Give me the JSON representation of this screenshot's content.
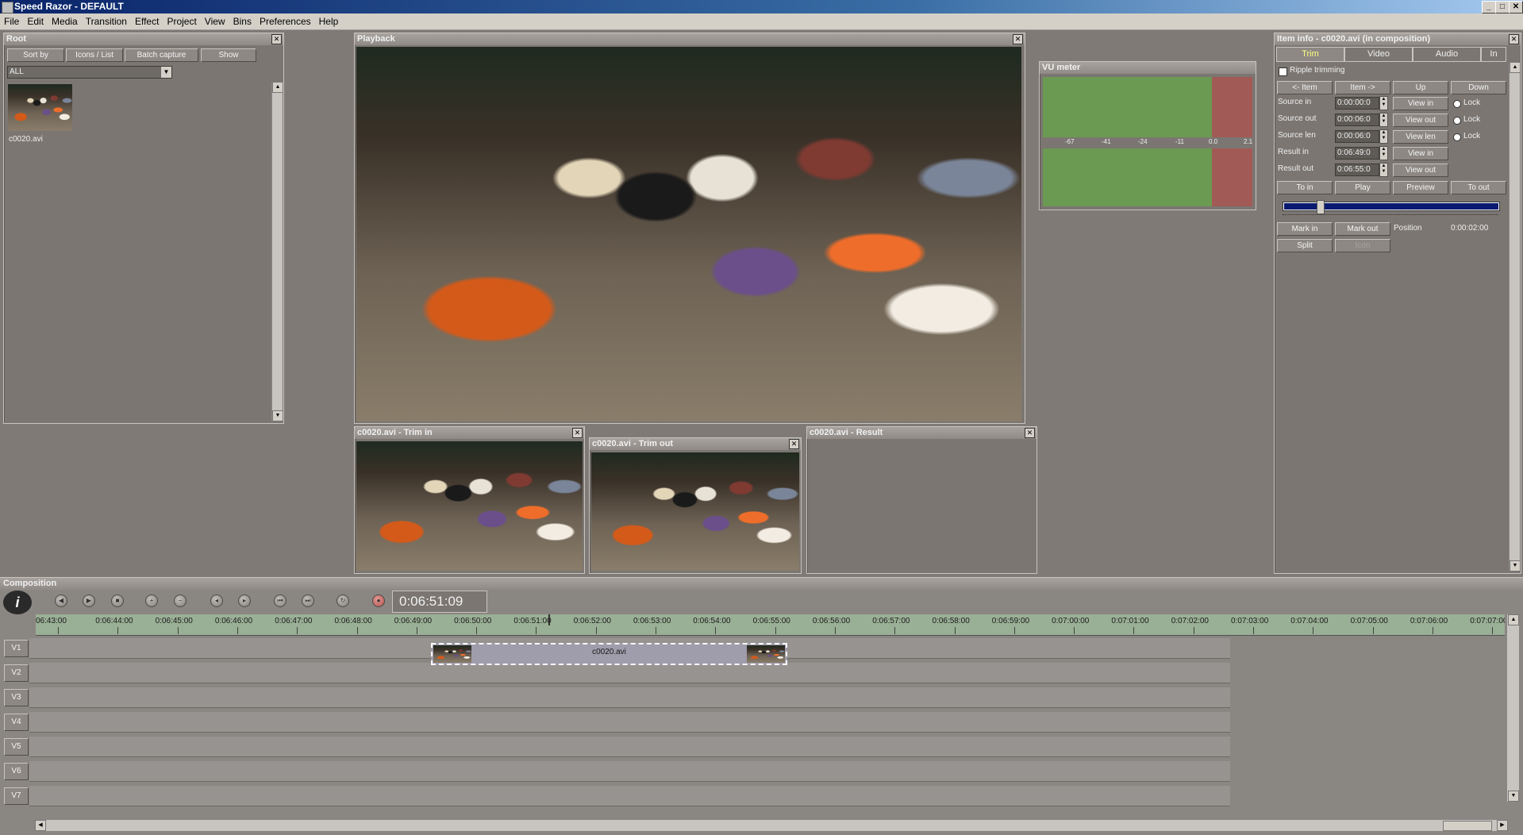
{
  "window": {
    "title": "Speed Razor - DEFAULT",
    "min": "_",
    "max": "□",
    "close": "✕"
  },
  "menu": [
    "File",
    "Edit",
    "Media",
    "Transition",
    "Effect",
    "Project",
    "View",
    "Bins",
    "Preferences",
    "Help"
  ],
  "root": {
    "title": "Root",
    "buttons": {
      "sort_by": "Sort by",
      "icons_list": "Icons / List",
      "batch_capture": "Batch capture",
      "show": "Show"
    },
    "filter": "ALL",
    "item_label": "c0020.avi"
  },
  "playback": {
    "title": "Playback"
  },
  "vu": {
    "title": "VU meter",
    "scale": [
      "-67",
      "-41",
      "-24",
      "-11",
      "0.0",
      "2.1"
    ],
    "green": "#6b9a52",
    "red": "#a25a56"
  },
  "trim_in": {
    "title": "c0020.avi - Trim in"
  },
  "trim_out": {
    "title": "c0020.avi - Trim out"
  },
  "result": {
    "title": "c0020.avi - Result"
  },
  "item_info": {
    "title": "Item info - c0020.avi (in composition)",
    "tabs": [
      "Trim",
      "Video",
      "Audio",
      "In"
    ],
    "ripple": "Ripple trimming",
    "nav": {
      "prev_item": "<- Item",
      "next_item": "Item ->",
      "up": "Up",
      "down": "Down"
    },
    "fields": [
      {
        "label": "Source in",
        "value": "0:00:00:0",
        "btn": "View in",
        "lock": "Lock"
      },
      {
        "label": "Source out",
        "value": "0:00:06:0",
        "btn": "View out",
        "lock": "Lock"
      },
      {
        "label": "Source len",
        "value": "0:00:06:0",
        "btn": "View len",
        "lock": "Lock"
      },
      {
        "label": "Result in",
        "value": "0:06:49:0",
        "btn": "View in"
      },
      {
        "label": "Result out",
        "value": "0:06:55:0",
        "btn": "View out"
      }
    ],
    "transport": {
      "to_in": "To in",
      "play": "Play",
      "preview": "Preview",
      "to_out": "To out"
    },
    "slider_value": 0.16,
    "mark_in": "Mark in",
    "mark_out": "Mark out",
    "position_label": "Position",
    "position_value": "0:00:02:00",
    "split": "Split",
    "icon": "Icon"
  },
  "composition": {
    "title": "Composition",
    "timecode": "0:06:51:09",
    "ruler": [
      "06:43:00",
      "0:06:44:00",
      "0:06:45:00",
      "0:06:46:00",
      "0:06:47:00",
      "0:06:48:00",
      "0:06:49:00",
      "0:06:50:00",
      "0:06:51:00",
      "0:06:52:00",
      "0:06:53:00",
      "0:06:54:00",
      "0:06:55:00",
      "0:06:56:00",
      "0:06:57:00",
      "0:06:58:00",
      "0:06:59:00",
      "0:07:00:00",
      "0:07:01:00",
      "0:07:02:00",
      "0:07:03:00",
      "0:07:04:00",
      "0:07:05:00",
      "0:07:06:00",
      "0:07:07:00"
    ],
    "tracks": [
      "V1",
      "V2",
      "V3",
      "V4",
      "V5",
      "V6",
      "V7"
    ],
    "clip_label": "c0020.avi",
    "transport_icons": [
      "rewind-icon",
      "play-icon",
      "stop-icon",
      "zoom-in-icon",
      "zoom-out-icon",
      "prev-frame-icon",
      "next-frame-icon",
      "go-start-icon",
      "go-end-icon",
      "loop-icon",
      "record-icon"
    ]
  }
}
